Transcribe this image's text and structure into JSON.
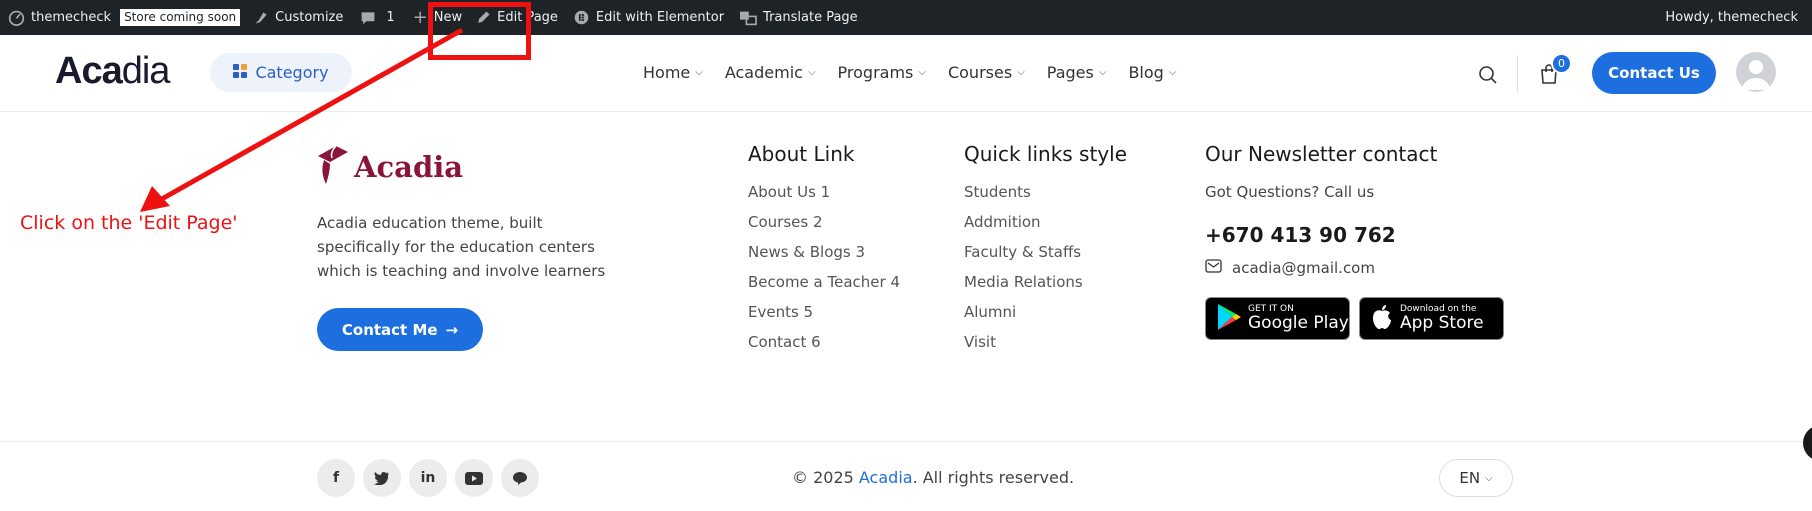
{
  "adminbar": {
    "site_name": "themecheck",
    "store_badge": "Store coming soon",
    "customize": "Customize",
    "comments_count": "1",
    "new": "New",
    "edit_page": "Edit Page",
    "edit_elementor": "Edit with Elementor",
    "translate_page": "Translate Page",
    "howdy": "Howdy, themecheck"
  },
  "header": {
    "logo_bold": "Aca",
    "logo_thin": "dia",
    "category": "Category",
    "nav": [
      {
        "label": "Home"
      },
      {
        "label": "Academic"
      },
      {
        "label": "Programs"
      },
      {
        "label": "Courses"
      },
      {
        "label": "Pages"
      },
      {
        "label": "Blog"
      }
    ],
    "cart_count": "0",
    "contact_btn": "Contact Us"
  },
  "footer": {
    "logo_text": "Acadia",
    "description": "Acadia education theme, built specifically for the education centers which is teaching and involve learners",
    "contact_me": "Contact Me",
    "about": {
      "title": "About Link",
      "links": [
        "About Us 1",
        "Courses 2",
        "News & Blogs 3",
        "Become a Teacher 4",
        "Events 5",
        "Contact 6"
      ]
    },
    "quick": {
      "title": "Quick links style",
      "links": [
        "Students",
        "Addmition",
        "Faculty & Staffs",
        "Media Relations",
        "Alumni",
        "Visit"
      ]
    },
    "newsletter": {
      "title": "Our Newsletter contact",
      "question": "Got Questions? Call us",
      "phone": "+670 413 90 762",
      "email": "acadia@gmail.com",
      "google_small": "GET IT ON",
      "google_big": "Google Play",
      "apple_small": "Download on the",
      "apple_big": "App Store"
    },
    "copyright_pre": "© 2025 ",
    "copyright_brand": "Acadia",
    "copyright_post": ". All rights reserved.",
    "lang": "EN"
  },
  "annotation": {
    "text": "Click on the 'Edit Page'",
    "color": "#ee1111"
  },
  "colors": {
    "accent": "#1d6fe0",
    "brand_maroon": "#8b1538",
    "adminbar_bg": "#1d2327"
  }
}
